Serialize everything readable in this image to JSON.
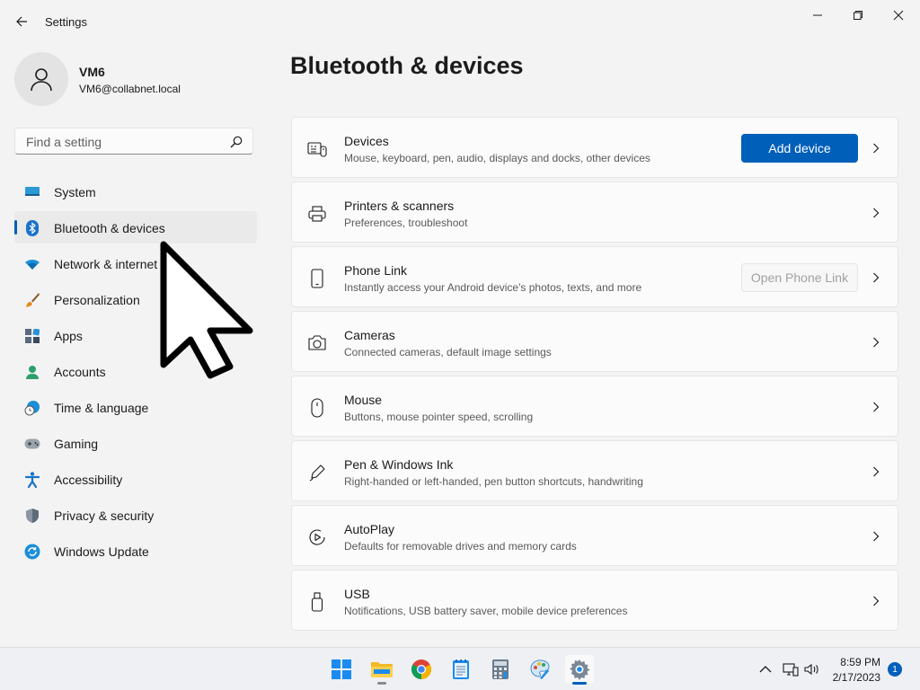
{
  "app": {
    "title": "Settings"
  },
  "user": {
    "name": "VM6",
    "email": "VM6@collabnet.local"
  },
  "search": {
    "placeholder": "Find a setting"
  },
  "nav": [
    {
      "label": "System",
      "icon": "monitor-icon"
    },
    {
      "label": "Bluetooth & devices",
      "icon": "bluetooth-icon",
      "selected": true
    },
    {
      "label": "Network & internet",
      "icon": "wifi-icon"
    },
    {
      "label": "Personalization",
      "icon": "brush-icon"
    },
    {
      "label": "Apps",
      "icon": "apps-icon"
    },
    {
      "label": "Accounts",
      "icon": "person-icon"
    },
    {
      "label": "Time & language",
      "icon": "clock-globe-icon"
    },
    {
      "label": "Gaming",
      "icon": "gamepad-icon"
    },
    {
      "label": "Accessibility",
      "icon": "accessibility-icon"
    },
    {
      "label": "Privacy & security",
      "icon": "shield-icon"
    },
    {
      "label": "Windows Update",
      "icon": "update-icon"
    }
  ],
  "page": {
    "title": "Bluetooth & devices"
  },
  "cards": [
    {
      "title": "Devices",
      "subtitle": "Mouse, keyboard, pen, audio, displays and docks, other devices",
      "button": "Add device",
      "icon": "devices-icon"
    },
    {
      "title": "Printers & scanners",
      "subtitle": "Preferences, troubleshoot",
      "icon": "printer-icon"
    },
    {
      "title": "Phone Link",
      "subtitle": "Instantly access your Android device's photos, texts, and more",
      "button": "Open Phone Link",
      "icon": "phone-icon"
    },
    {
      "title": "Cameras",
      "subtitle": "Connected cameras, default image settings",
      "icon": "camera-icon"
    },
    {
      "title": "Mouse",
      "subtitle": "Buttons, mouse pointer speed, scrolling",
      "icon": "mouse-icon"
    },
    {
      "title": "Pen & Windows Ink",
      "subtitle": "Right-handed or left-handed, pen button shortcuts, handwriting",
      "icon": "pen-icon"
    },
    {
      "title": "AutoPlay",
      "subtitle": "Defaults for removable drives and memory cards",
      "icon": "autoplay-icon"
    },
    {
      "title": "USB",
      "subtitle": "Notifications, USB battery saver, mobile device preferences",
      "icon": "usb-icon"
    }
  ],
  "taskbar": {
    "apps": [
      "windows-start-icon",
      "file-explorer-icon",
      "chrome-icon",
      "notepad-icon",
      "calculator-icon",
      "paint-icon",
      "settings-icon"
    ],
    "time": "8:59 PM",
    "date": "2/17/2023",
    "notifications": "1"
  },
  "colors": {
    "accent": "#005fb8",
    "background": "#f3f3f3",
    "card": "#fbfbfb"
  }
}
